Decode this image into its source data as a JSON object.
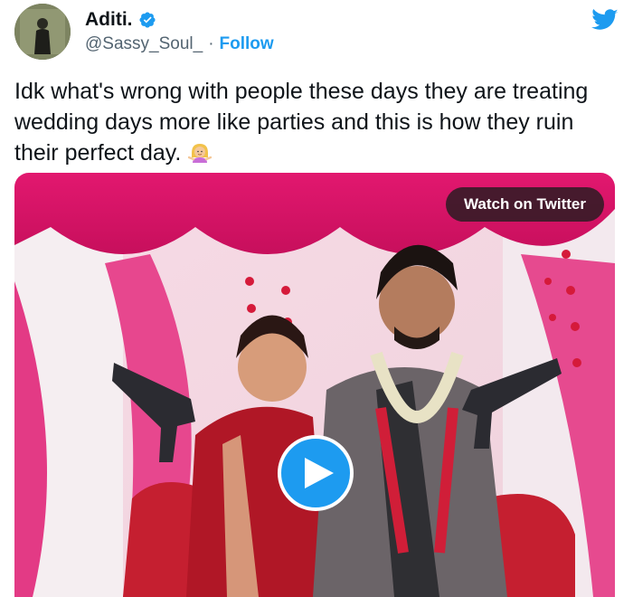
{
  "author": {
    "display_name": "Aditi.",
    "handle": "@Sassy_Soul_",
    "separator": "·",
    "follow_label": "Follow",
    "verified": true,
    "avatar": "profile-photo"
  },
  "brand": {
    "logo": "twitter-bird-icon",
    "color": "#1d9bf0"
  },
  "tweet": {
    "text": "Idk what's wrong with people these days they are treating wedding days more like parties and this is how they ruin their perfect day.",
    "emoji": "woman-shrugging"
  },
  "media": {
    "type": "video",
    "watch_label": "Watch on Twitter",
    "play_icon": "play-icon",
    "description": ""
  },
  "colors": {
    "text": "#0f1419",
    "secondary": "#536471",
    "accent": "#1d9bf0"
  }
}
